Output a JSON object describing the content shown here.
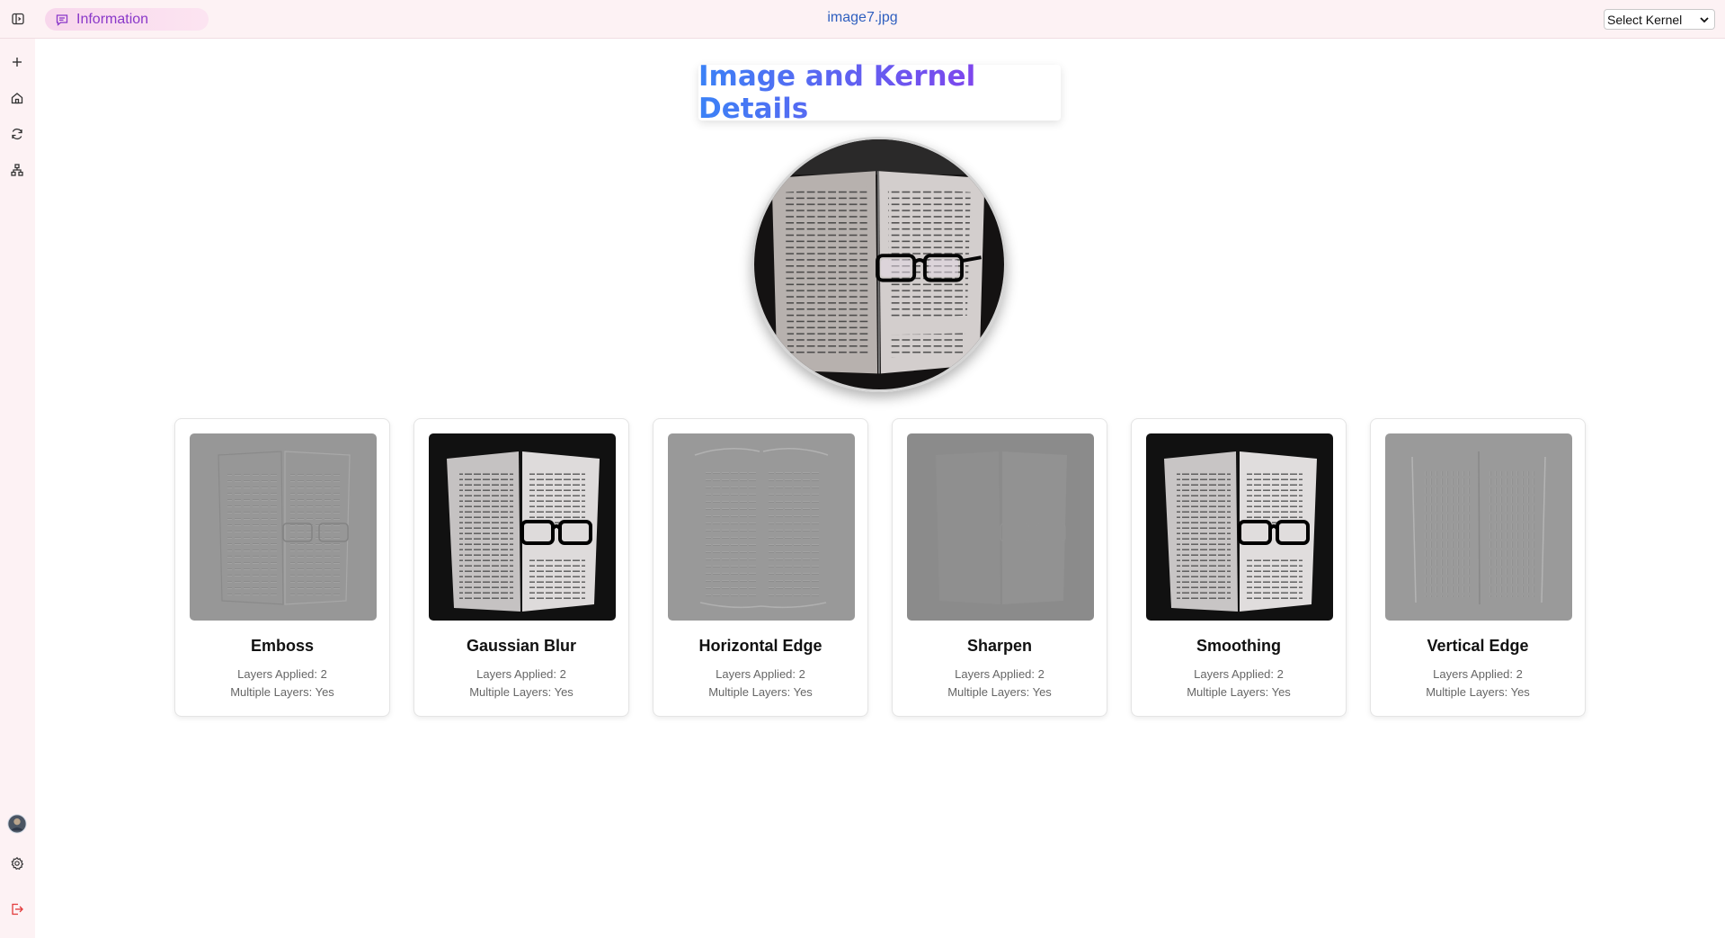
{
  "topbar": {
    "info_label": "Information",
    "file_name": "image7.jpg",
    "kernel_select": {
      "value": "Select Kernel"
    }
  },
  "sidebar": {
    "icons": [
      "toggle-sidebar-icon",
      "plus-icon",
      "home-icon",
      "refresh-icon",
      "network-icon",
      "avatar",
      "settings-icon",
      "logout-icon"
    ]
  },
  "main": {
    "title": "Image and Kernel Details",
    "cards": [
      {
        "name": "Emboss",
        "layers": "Layers Applied: 2",
        "multiple": "Multiple Layers: Yes"
      },
      {
        "name": "Gaussian Blur",
        "layers": "Layers Applied: 2",
        "multiple": "Multiple Layers: Yes"
      },
      {
        "name": "Horizontal Edge",
        "layers": "Layers Applied: 2",
        "multiple": "Multiple Layers: Yes"
      },
      {
        "name": "Sharpen",
        "layers": "Layers Applied: 2",
        "multiple": "Multiple Layers: Yes"
      },
      {
        "name": "Smoothing",
        "layers": "Layers Applied: 2",
        "multiple": "Multiple Layers: Yes"
      },
      {
        "name": "Vertical Edge",
        "layers": "Layers Applied: 2",
        "multiple": "Multiple Layers: Yes"
      }
    ]
  },
  "colors": {
    "title_gradient_start": "#3b82f6",
    "title_gradient_end": "#9333ea",
    "chrome_background": "#fdf2f4",
    "logout_icon": "#e23a3a"
  }
}
